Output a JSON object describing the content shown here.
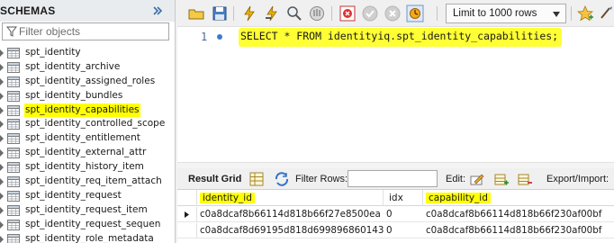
{
  "schemas": {
    "title": "SCHEMAS",
    "filter_placeholder": "Filter objects",
    "tables": [
      {
        "label": "spt_identity",
        "highlighted": false
      },
      {
        "label": "spt_identity_archive",
        "highlighted": false
      },
      {
        "label": "spt_identity_assigned_roles",
        "highlighted": false
      },
      {
        "label": "spt_identity_bundles",
        "highlighted": false
      },
      {
        "label": "spt_identity_capabilities",
        "highlighted": true
      },
      {
        "label": "spt_identity_controlled_scope",
        "highlighted": false
      },
      {
        "label": "spt_identity_entitlement",
        "highlighted": false
      },
      {
        "label": "spt_identity_external_attr",
        "highlighted": false
      },
      {
        "label": "spt_identity_history_item",
        "highlighted": false
      },
      {
        "label": "spt_identity_req_item_attach",
        "highlighted": false
      },
      {
        "label": "spt_identity_request",
        "highlighted": false
      },
      {
        "label": "spt_identity_request_item",
        "highlighted": false
      },
      {
        "label": "spt_identity_request_sequen",
        "highlighted": false
      },
      {
        "label": "spt_identity_role_metadata",
        "highlighted": false
      }
    ]
  },
  "toolbar": {
    "icons": [
      "open-folder-icon",
      "save-icon",
      "execute-icon",
      "execute-current-icon",
      "explain-icon",
      "stop-icon",
      "toggle-error-icon",
      "commit-icon",
      "rollback-icon",
      "autocommit-icon",
      "add-snippet-icon",
      "beautify-icon"
    ],
    "limit_label": "Limit to 1000 rows"
  },
  "editor": {
    "line_number": "1",
    "sql": "SELECT * FROM identityiq.spt_identity_capabilities;"
  },
  "result": {
    "grid_label": "Result Grid",
    "filter_rows_label": "Filter Rows:",
    "filter_rows_value": "",
    "edit_label": "Edit:",
    "export_label": "Export/Import:",
    "columns": [
      {
        "label": "identity_id",
        "highlighted": true
      },
      {
        "label": "idx",
        "highlighted": false
      },
      {
        "label": "capability_id",
        "highlighted": true
      }
    ],
    "rows": [
      {
        "identity_id": "c0a8dcaf8b66114d818b66f27e8500ea",
        "idx": "0",
        "capability_id": "c0a8dcaf8b66114d818b66f230af00bf",
        "selected": true
      },
      {
        "identity_id": "c0a8dcaf8d69195d818d699896860143",
        "idx": "0",
        "capability_id": "c0a8dcaf8b66114d818b66f230af00bf",
        "selected": false
      }
    ]
  },
  "colors": {
    "highlight": "#ffff00",
    "accent_blue": "#3d7cc9",
    "panel_bg": "#f0f0f0"
  }
}
